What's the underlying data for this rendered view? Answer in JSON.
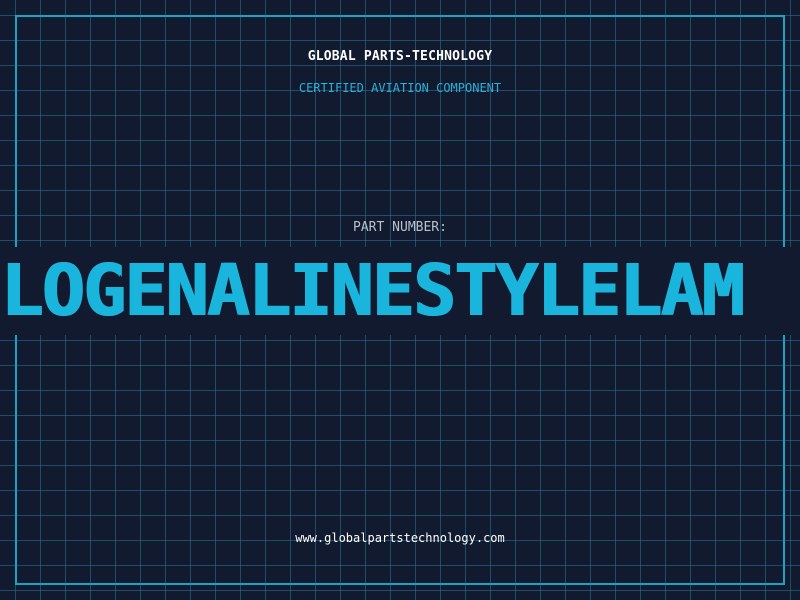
{
  "header": {
    "company": "GLOBAL PARTS-TECHNOLOGY",
    "tagline": "CERTIFIED AVIATION COMPONENT"
  },
  "part": {
    "label": "PART NUMBER:",
    "number": "LOGENALINESTYLELAM"
  },
  "footer": {
    "website": "www.globalpartstechnology.com"
  },
  "colors": {
    "background": "#111a2e",
    "grid": "#28788f",
    "accent": "#19b5dd",
    "text": "#ffffff",
    "muted": "#b9c2cf"
  }
}
